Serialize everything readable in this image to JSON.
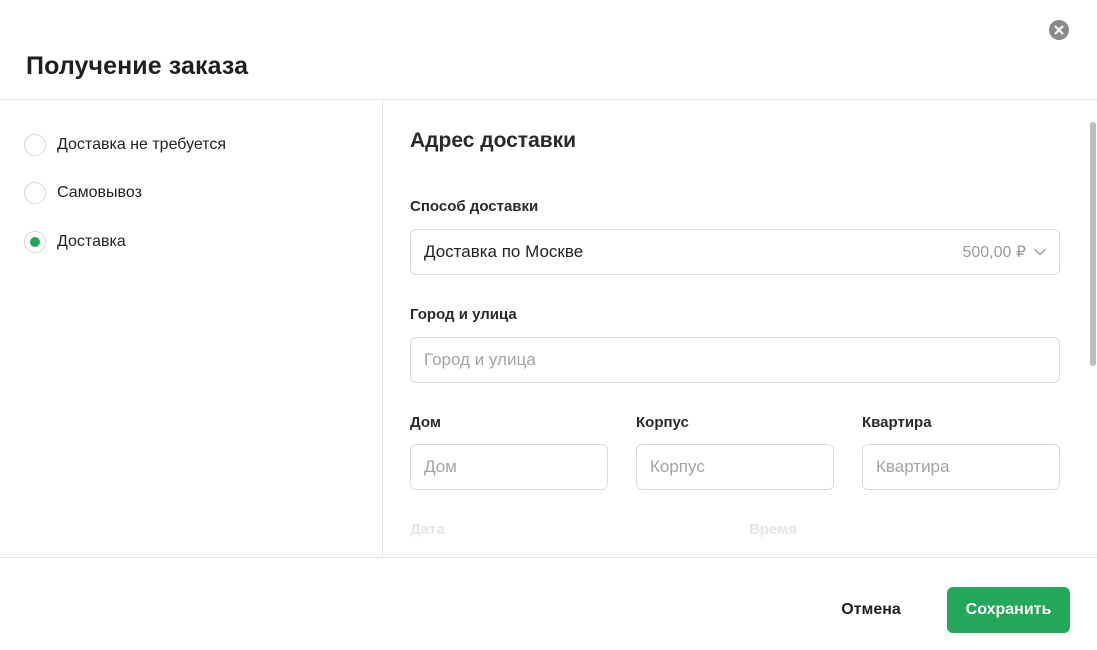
{
  "dialog": {
    "title": "Получение заказа"
  },
  "options": [
    {
      "label": "Доставка не требуется",
      "selected": false
    },
    {
      "label": "Самовывоз",
      "selected": false
    },
    {
      "label": "Доставка",
      "selected": true
    }
  ],
  "address": {
    "section_title": "Адрес доставки",
    "method": {
      "label": "Способ доставки",
      "value": "Доставка по Москве",
      "price": "500,00 ₽"
    },
    "city": {
      "label": "Город и улица",
      "placeholder": "Город и улица",
      "value": ""
    },
    "house": {
      "label": "Дом",
      "placeholder": "Дом",
      "value": ""
    },
    "building": {
      "label": "Корпус",
      "placeholder": "Корпус",
      "value": ""
    },
    "apartment": {
      "label": "Квартира",
      "placeholder": "Квартира",
      "value": ""
    },
    "date_label": "Дата",
    "time_label": "Время"
  },
  "footer": {
    "cancel_label": "Отмена",
    "save_label": "Сохранить"
  },
  "colors": {
    "accent": "#23a85a",
    "close_icon_bg": "#8a8a8a"
  },
  "icons": {
    "close": "close-icon",
    "chevron": "chevron-down-icon",
    "radio_selected": "radio-dot"
  }
}
